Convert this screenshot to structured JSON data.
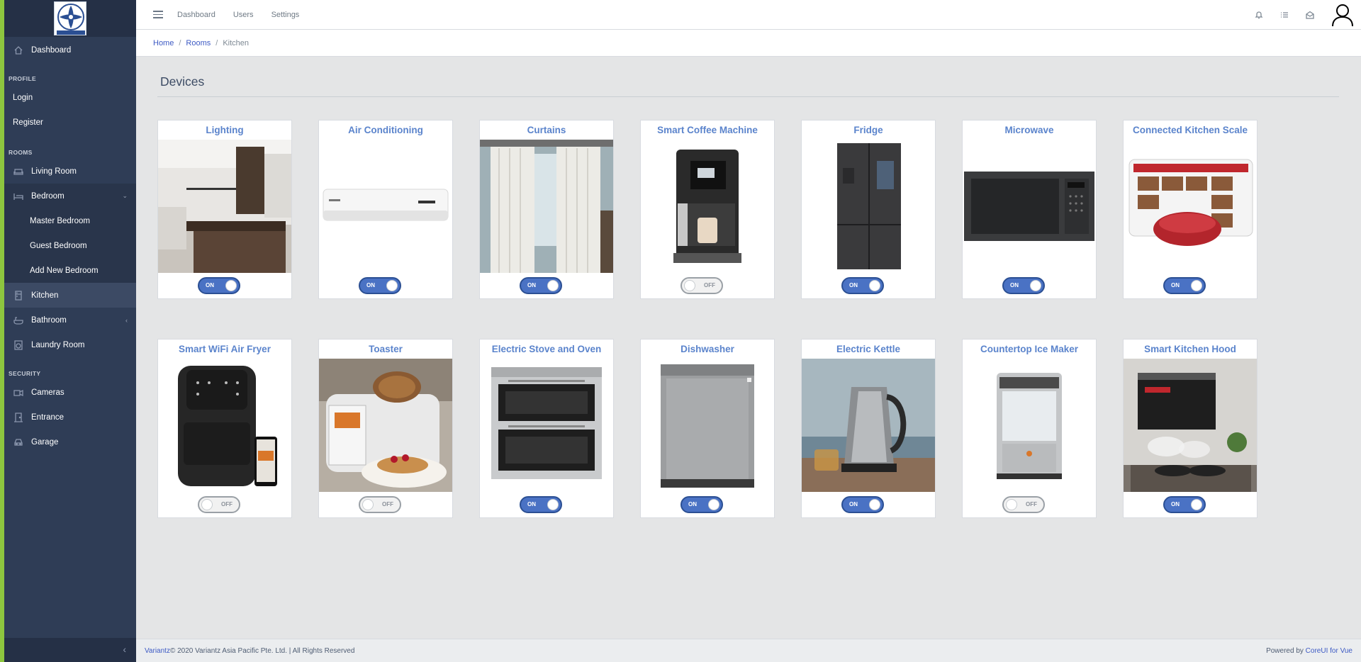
{
  "brand": {
    "logo_text": "VARIANTZ"
  },
  "sidebar": {
    "dashboard": "Dashboard",
    "profile_title": "PROFILE",
    "login": "Login",
    "register": "Register",
    "rooms_title": "ROOMS",
    "living_room": "Living Room",
    "bedroom": "Bedroom",
    "master_bedroom": "Master Bedroom",
    "guest_bedroom": "Guest Bedroom",
    "add_new_bedroom": "Add New Bedroom",
    "kitchen": "Kitchen",
    "bathroom": "Bathroom",
    "laundry_room": "Laundry Room",
    "security_title": "SECURITY",
    "cameras": "Cameras",
    "entrance": "Entrance",
    "garage": "Garage"
  },
  "header": {
    "nav_dashboard": "Dashboard",
    "nav_users": "Users",
    "nav_settings": "Settings"
  },
  "breadcrumb": {
    "home": "Home",
    "rooms": "Rooms",
    "current": "Kitchen"
  },
  "main": {
    "title": "Devices"
  },
  "devices": [
    {
      "name": "Lighting",
      "state": "ON",
      "on": true
    },
    {
      "name": "Air Conditioning",
      "state": "ON",
      "on": true
    },
    {
      "name": "Curtains",
      "state": "ON",
      "on": true
    },
    {
      "name": "Smart Coffee Machine",
      "state": "OFF",
      "on": false
    },
    {
      "name": "Fridge",
      "state": "ON",
      "on": true
    },
    {
      "name": "Microwave",
      "state": "ON",
      "on": true
    },
    {
      "name": "Connected Kitchen Scale",
      "state": "ON",
      "on": true
    },
    {
      "name": "Smart WiFi Air Fryer",
      "state": "OFF",
      "on": false
    },
    {
      "name": "Toaster",
      "state": "OFF",
      "on": false
    },
    {
      "name": "Electric Stove and Oven",
      "state": "ON",
      "on": true
    },
    {
      "name": "Dishwasher",
      "state": "ON",
      "on": true
    },
    {
      "name": "Electric Kettle",
      "state": "ON",
      "on": true
    },
    {
      "name": "Countertop Ice Maker",
      "state": "OFF",
      "on": false
    },
    {
      "name": "Smart Kitchen Hood",
      "state": "ON",
      "on": true
    }
  ],
  "footer": {
    "brand_link": "Variantz",
    "copyright": " © 2020 Variantz Asia Pacific Pte. Ltd. | All Rights Reserved",
    "powered_by": "Powered by ",
    "coreui_link": "CoreUI for Vue"
  },
  "colors": {
    "accent": "#4a72c4",
    "sidebar": "#2f3d56",
    "card_title": "#5b84cc",
    "frame": "#8dc63f"
  }
}
